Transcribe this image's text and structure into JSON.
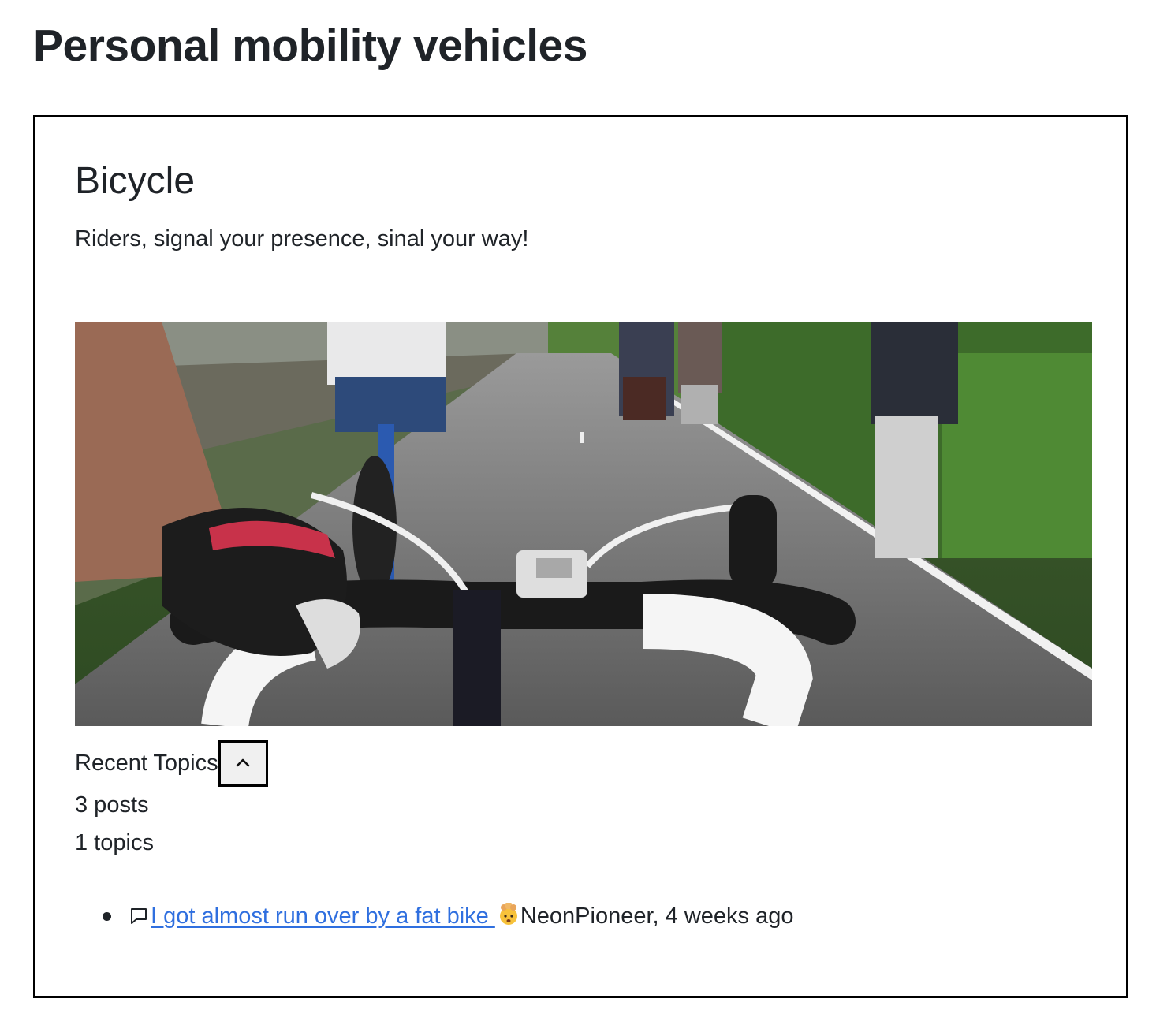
{
  "page": {
    "title": "Personal mobility vehicles"
  },
  "card": {
    "title": "Bicycle",
    "description": "Riders, signal your presence, sinal your way!",
    "recent_topics_label": "Recent Topics",
    "posts_count": "3 posts",
    "topics_count": "1 topics",
    "topics": [
      {
        "title": "I got almost run over by a fat bike ",
        "emoji": "exploding-head-emoji",
        "author_meta": "NeonPioneer, 4 weeks ago"
      }
    ]
  },
  "icons": {
    "toggle": "chevron-up-icon",
    "topic": "comment-icon"
  },
  "colors": {
    "link": "#2f6fdf",
    "text": "#1f2328",
    "border": "#000000"
  }
}
